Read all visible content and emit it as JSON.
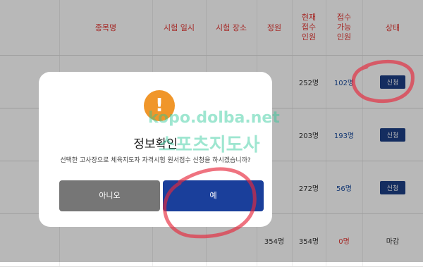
{
  "table": {
    "headers": [
      "종목명",
      "시험 일시",
      "시험 장소",
      "정원",
      "현재\n접수\n인원",
      "접수\n가능\n인원",
      "상태"
    ],
    "rows": [
      {
        "capacity": "",
        "current": "252명",
        "available": "102명",
        "status": "신청"
      },
      {
        "capacity": "",
        "current": "203명",
        "available": "193명",
        "status": "신청"
      },
      {
        "capacity": "",
        "current": "272명",
        "available": "56명",
        "status": "신청"
      },
      {
        "capacity": "354명",
        "current": "354명",
        "available": "0명",
        "status": "마감"
      }
    ]
  },
  "modal": {
    "icon": "!",
    "title": "정보확인",
    "message": "선택한 고사장으로 체육지도자 자격시험 원서접수 신청을 하시겠습니까?",
    "no_label": "아니오",
    "yes_label": "예"
  },
  "watermark": {
    "line1": "kopo.dolba.net",
    "line2": "스포츠지도사"
  }
}
